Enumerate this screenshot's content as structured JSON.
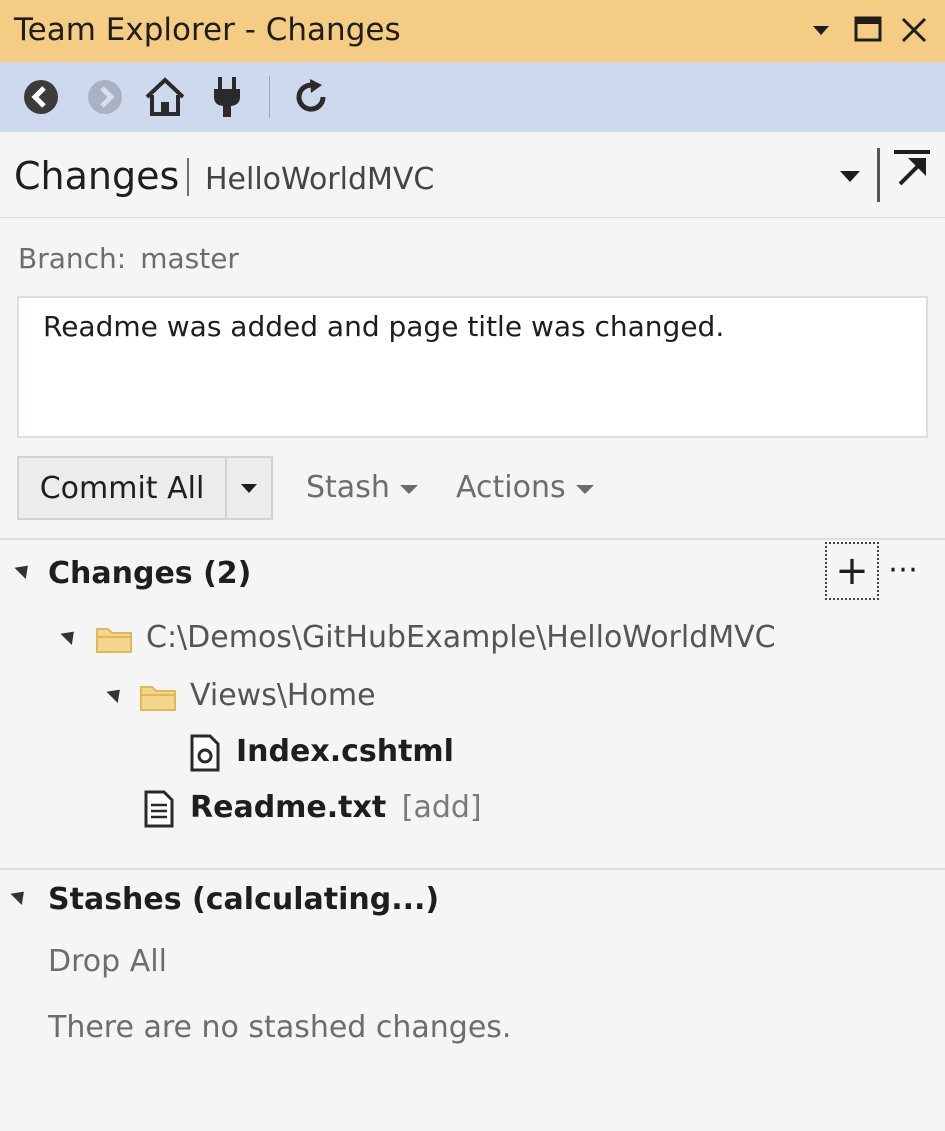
{
  "window": {
    "title": "Team Explorer - Changes",
    "controls": [
      "chevron-down-icon",
      "maximize-icon",
      "close-icon"
    ]
  },
  "toolbar": {
    "buttons": [
      "back-icon",
      "forward-icon",
      "home-icon",
      "connect-icon",
      "refresh-icon"
    ]
  },
  "header": {
    "title": "Changes",
    "separator": "|",
    "repo": "HelloWorldMVC"
  },
  "branch": {
    "label": "Branch:",
    "name": "master"
  },
  "commit": {
    "message": "Readme was added and page title was changed.",
    "commit_all_label": "Commit All",
    "stash_label": "Stash",
    "actions_label": "Actions"
  },
  "changes": {
    "heading": "Changes (2)",
    "stage_label": "+",
    "more_label": "⋯",
    "tree": {
      "root_path": "C:\\Demos\\GitHubExample\\HelloWorldMVC",
      "folder": "Views\\Home",
      "file1": "Index.cshtml",
      "file2": "Readme.txt",
      "file2_status": "[add]"
    }
  },
  "stashes": {
    "heading": "Stashes (calculating...)",
    "drop_all_label": "Drop All",
    "empty_text": "There are no stashed changes."
  },
  "colors": {
    "title_bar": "#f5cc84",
    "toolbar": "#cfd9ee",
    "background": "#f5f5f5",
    "folder": "#e8c46a"
  }
}
